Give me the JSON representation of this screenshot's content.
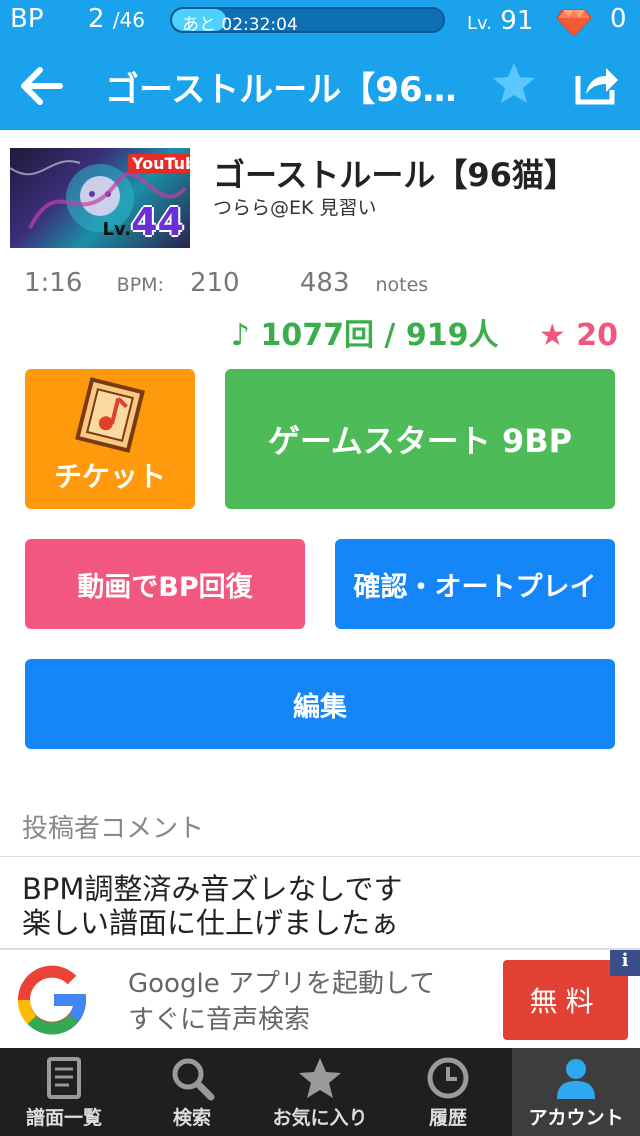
{
  "status": {
    "bp_label": "BP",
    "bp_current": "2",
    "bp_total": "/46",
    "timer_text": "あと 02:32:04",
    "timer_progress_percent": 20,
    "level_label": "Lv.",
    "level_value": "91",
    "gems": "0"
  },
  "nav": {
    "title": "ゴーストルール【96…"
  },
  "song": {
    "thumb_badge": "YouTube",
    "level_prefix": "Lv.",
    "level": "44",
    "title": "ゴーストルール【96猫】",
    "author": "つらら@EK 見習い",
    "duration": "1:16",
    "bpm_label": "BPM:",
    "bpm": "210",
    "notes": "483",
    "notes_label": "notes",
    "plays": "♪ 1077回 / 919人",
    "favorites": "★ 20"
  },
  "buttons": {
    "ticket": "チケット",
    "start": "ゲームスタート 9BP",
    "recover": "動画でBP回復",
    "auto": "確認・オートプレイ",
    "edit": "編集"
  },
  "comment": {
    "header": "投稿者コメント",
    "line1": "BPM調整済み音ズレなしです",
    "line2": "楽しい譜面に仕上げましたぁ"
  },
  "ad": {
    "line1": "Google アプリを起動して",
    "line2": "すぐに音声検索",
    "button": "無料",
    "info": "i"
  },
  "tabs": [
    {
      "label": "譜面一覧",
      "icon": "document-icon"
    },
    {
      "label": "検索",
      "icon": "search-icon"
    },
    {
      "label": "お気に入り",
      "icon": "star-icon"
    },
    {
      "label": "履歴",
      "icon": "clock-icon"
    },
    {
      "label": "アカウント",
      "icon": "person-icon"
    }
  ],
  "colors": {
    "header": "#1aa3ec",
    "ticket": "#ff9a0d",
    "start": "#4cbb58",
    "recover": "#f2587f",
    "primary": "#1486f8",
    "plays": "#3aae4a",
    "favorites": "#f2557f"
  }
}
